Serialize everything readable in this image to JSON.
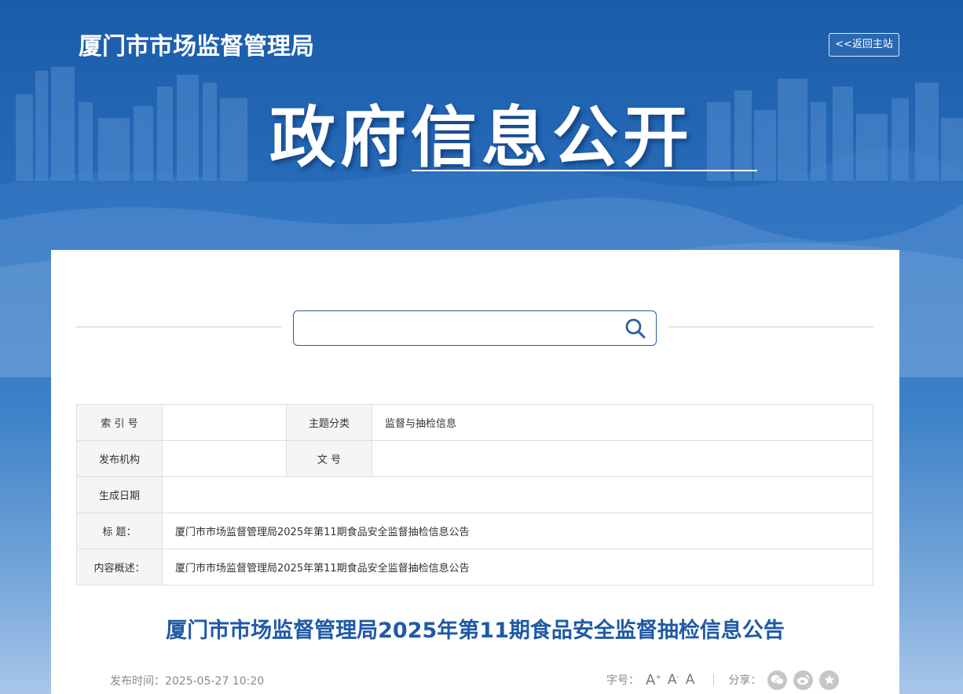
{
  "header": {
    "site_title": "厦门市市场监督管理局",
    "back_home_label": "<<返回主站",
    "hero_title": "政府信息公开"
  },
  "search": {
    "placeholder": ""
  },
  "meta_table": {
    "index_label": "索 引 号",
    "index_value": "",
    "topic_label": "主题分类",
    "topic_value": "监督与抽检信息",
    "publisher_label": "发布机构",
    "publisher_value": "",
    "docno_label": "文 号",
    "docno_value": "",
    "date_label": "生成日期",
    "date_value": "",
    "title_label": "标 题：",
    "title_value": "厦门市市场监督管理局2025年第11期食品安全监督抽检信息公告",
    "summary_label": "内容概述：",
    "summary_value": "厦门市市场监督管理局2025年第11期食品安全监督抽检信息公告"
  },
  "article": {
    "title": "厦门市市场监督管理局2025年第11期食品安全监督抽检信息公告",
    "publish_time": "发布时间：2025-05-27 10:20"
  },
  "tools": {
    "font_size_label": "字号：",
    "font_large": "A",
    "font_medium": "A",
    "font_small": "A",
    "share_label": "分享："
  },
  "icons": {
    "search": "search-icon",
    "wechat": "wechat-icon",
    "weibo": "weibo-icon",
    "favorite": "star-icon"
  },
  "colors": {
    "banner_blue": "#1a5caa",
    "title_blue": "#1f5aa6",
    "label_bg": "#f4f5f7"
  }
}
